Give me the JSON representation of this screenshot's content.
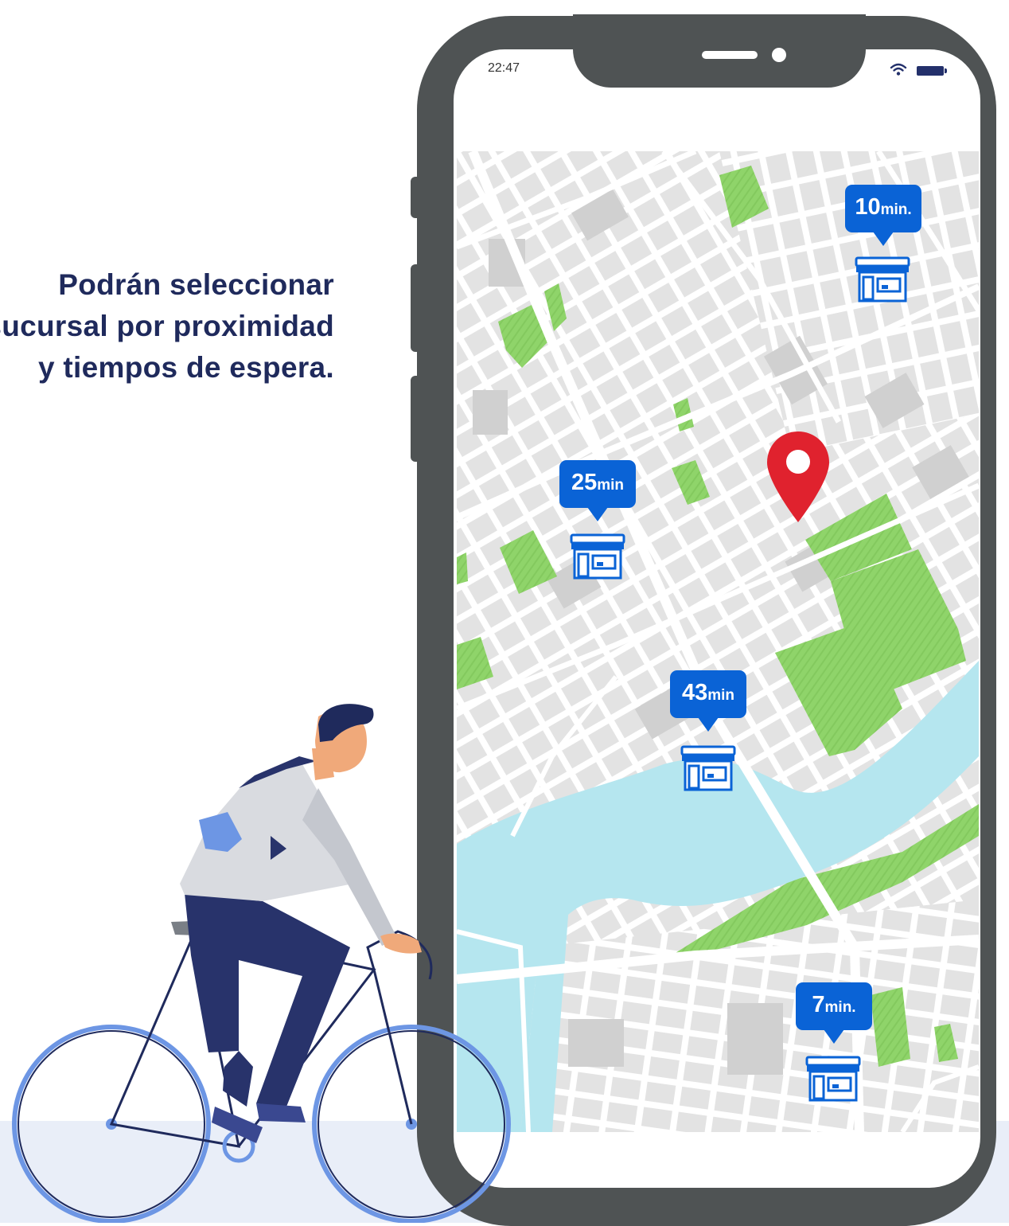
{
  "caption": {
    "lines": [
      "Podrán seleccionar",
      "sucursal por proximidad",
      "y tiempos de espera."
    ]
  },
  "status_bar": {
    "time": "22:47",
    "icons": [
      "wifi-icon",
      "battery-icon"
    ]
  },
  "map": {
    "markers": [
      {
        "number": "10",
        "unit": "min.",
        "icon": "store-icon"
      },
      {
        "number": "25",
        "unit": "min",
        "icon": "store-icon"
      },
      {
        "number": "43",
        "unit": "min",
        "icon": "store-icon"
      },
      {
        "number": "7",
        "unit": "min.",
        "icon": "store-icon"
      }
    ],
    "user_location_icon": "map-pin-icon"
  },
  "colors": {
    "accent_blue": "#0a63d6",
    "pin_red": "#e0222e",
    "phone_frame": "#4f5354",
    "caption_text": "#1f2a5c",
    "park_green": "#8fd46a",
    "water_blue": "#b5e6ef",
    "block_gray": "#e3e3e3"
  },
  "illustration": {
    "figure": "cyclist-illustration"
  }
}
